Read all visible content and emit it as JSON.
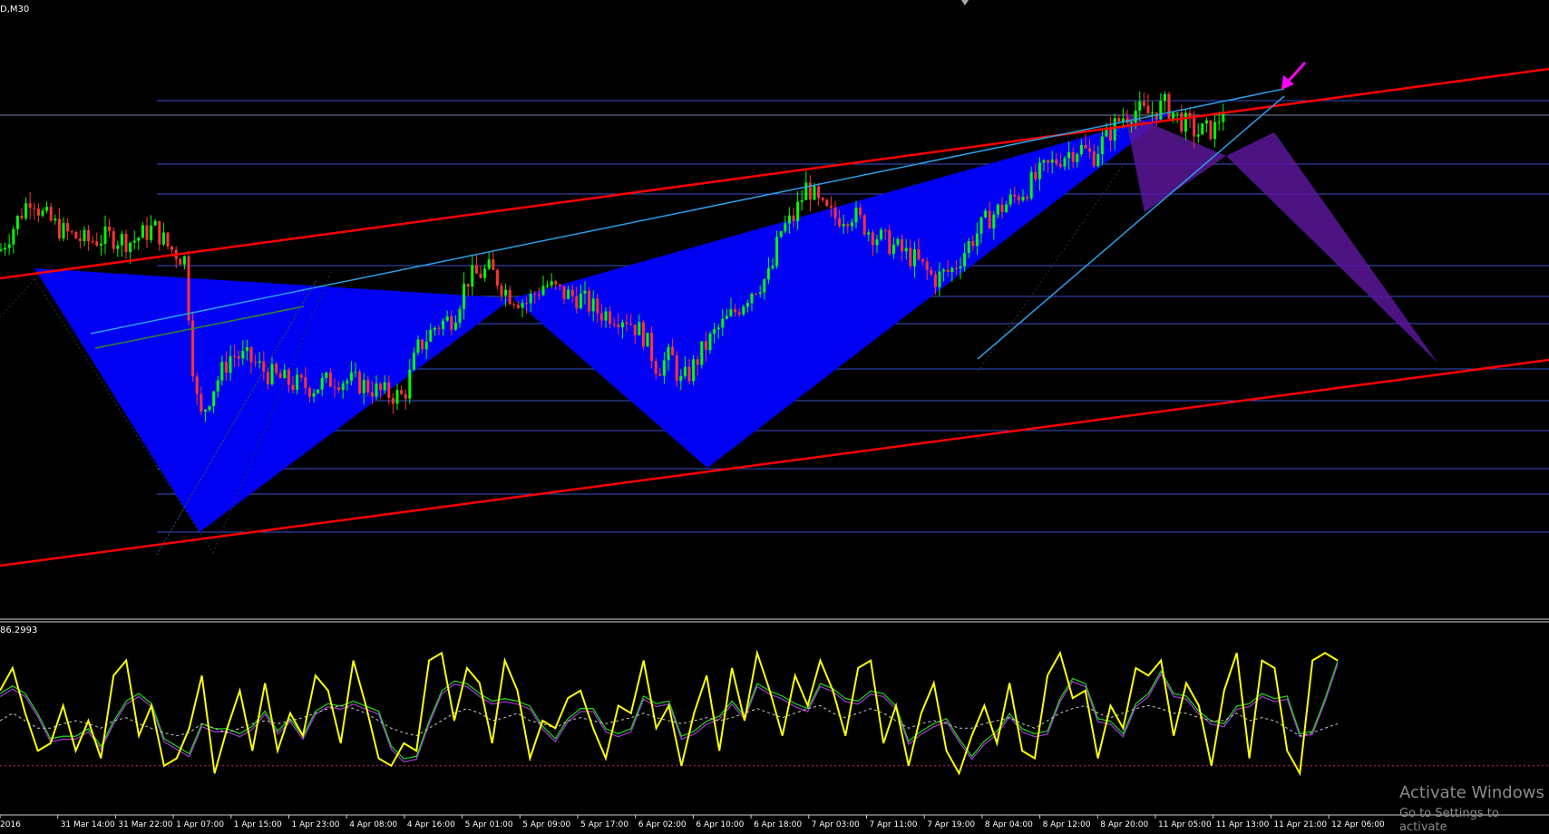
{
  "window": {
    "symbol_label": "D,M30"
  },
  "osc_label": "86.2993",
  "watermark": {
    "title": "Activate Windows",
    "subtitle": "Go to Settings to activate"
  },
  "colors": {
    "background": "#000000",
    "candle_up": "#00ff00",
    "candle_down": "#ff3333",
    "grid": "#3a50c8",
    "pattern_fill": "#0000ff",
    "pattern2_fill": "#5a169a",
    "trend_red": "#ff0000",
    "trend_blue": "#2aa0e8",
    "trend_green": "#2e8b2e",
    "arrow": "#ff00ff",
    "osc_main": "#ffff00",
    "osc_signal_a": "#22cc22",
    "osc_signal_b": "#9a3ad0",
    "osc_ma": "#cccccc",
    "osc_level": "#cc2266"
  },
  "chart_data": [
    {
      "type": "candlestick",
      "timeframe": "M30",
      "x_ticks": [
        "2016",
        "31 Mar 14:00",
        "31 Mar 22:00",
        "1 Apr 07:00",
        "1 Apr 15:00",
        "1 Apr 23:00",
        "4 Apr 08:00",
        "4 Apr 16:00",
        "5 Apr 01:00",
        "5 Apr 09:00",
        "5 Apr 17:00",
        "6 Apr 02:00",
        "6 Apr 10:00",
        "6 Apr 18:00",
        "7 Apr 03:00",
        "7 Apr 11:00",
        "7 Apr 19:00",
        "8 Apr 04:00",
        "8 Apr 12:00",
        "8 Apr 20:00",
        "11 Apr 05:00",
        "11 Apr 13:00",
        "11 Apr 21:00",
        "12 Apr 06:00"
      ],
      "ylim": [
        0,
        100
      ],
      "price_path": [
        [
          0,
          66
        ],
        [
          35,
          78
        ],
        [
          45,
          74
        ],
        [
          70,
          70
        ],
        [
          95,
          68
        ],
        [
          120,
          69
        ],
        [
          145,
          68
        ],
        [
          170,
          71
        ],
        [
          185,
          67
        ],
        [
          205,
          64
        ],
        [
          210,
          46
        ],
        [
          220,
          30
        ],
        [
          235,
          37
        ],
        [
          255,
          44
        ],
        [
          275,
          43
        ],
        [
          295,
          40
        ],
        [
          320,
          38
        ],
        [
          345,
          37
        ],
        [
          370,
          39
        ],
        [
          395,
          38
        ],
        [
          420,
          36
        ],
        [
          445,
          35
        ],
        [
          460,
          45
        ],
        [
          480,
          50
        ],
        [
          500,
          52
        ],
        [
          515,
          60
        ],
        [
          540,
          62
        ],
        [
          560,
          57
        ],
        [
          580,
          55
        ],
        [
          600,
          59
        ],
        [
          620,
          57
        ],
        [
          640,
          56
        ],
        [
          660,
          53
        ],
        [
          690,
          52
        ],
        [
          710,
          48
        ],
        [
          725,
          41
        ],
        [
          740,
          44
        ],
        [
          750,
          38
        ],
        [
          760,
          40
        ],
        [
          775,
          45
        ],
        [
          790,
          49
        ],
        [
          810,
          53
        ],
        [
          830,
          58
        ],
        [
          850,
          61
        ],
        [
          860,
          70
        ],
        [
          875,
          73
        ],
        [
          890,
          80
        ],
        [
          905,
          75
        ],
        [
          920,
          73
        ],
        [
          940,
          74
        ],
        [
          960,
          70
        ],
        [
          985,
          67
        ],
        [
          1010,
          64
        ],
        [
          1030,
          60
        ],
        [
          1050,
          62
        ],
        [
          1070,
          68
        ],
        [
          1090,
          73
        ],
        [
          1110,
          76
        ],
        [
          1130,
          79
        ],
        [
          1150,
          83
        ],
        [
          1170,
          86
        ],
        [
          1190,
          88
        ],
        [
          1205,
          86
        ],
        [
          1215,
          89
        ],
        [
          1235,
          94
        ],
        [
          1250,
          96
        ],
        [
          1265,
          95
        ],
        [
          1285,
          97
        ],
        [
          1300,
          94
        ],
        [
          1320,
          91
        ],
        [
          1340,
          92
        ],
        [
          1352,
          98
        ]
      ],
      "horizontal_levels": [
        111,
        127,
        181,
        214,
        293,
        327,
        357,
        407,
        442,
        475,
        517,
        545,
        587
      ],
      "pattern_1": {
        "points": [
          [
            38,
            296
          ],
          [
            220,
            587
          ],
          [
            565,
            329
          ],
          [
            780,
            516
          ],
          [
            1292,
            124
          ]
        ]
      },
      "pattern_2": {
        "points": [
          [
            1240,
            124
          ],
          [
            1262,
            234
          ],
          [
            1352,
            172
          ],
          [
            1405,
            146
          ],
          [
            1585,
            400
          ]
        ]
      },
      "trendlines": [
        {
          "color": "red",
          "from": [
            0,
            307
          ],
          "to": [
            1708,
            76
          ]
        },
        {
          "color": "red",
          "from": [
            0,
            624
          ],
          "to": [
            1708,
            397
          ]
        },
        {
          "color": "blue",
          "from": [
            100,
            368
          ],
          "to": [
            1416,
            98
          ]
        },
        {
          "color": "blue",
          "from": [
            1078,
            396
          ],
          "to": [
            1416,
            106
          ]
        }
      ],
      "arrow_marker": {
        "at": [
          1413,
          99
        ]
      }
    },
    {
      "type": "line",
      "name": "oscillator",
      "ylim": [
        0,
        100
      ],
      "level_lines": [
        20
      ],
      "series": [
        {
          "values": [
            70,
            85,
            55,
            30,
            35,
            60,
            30,
            50,
            25,
            80,
            90,
            40,
            60,
            20,
            25,
            45,
            80,
            15,
            45,
            70,
            30,
            75,
            30,
            55,
            40,
            80,
            70,
            35,
            90,
            60,
            25,
            20,
            35,
            30,
            90,
            95,
            50,
            85,
            75,
            35,
            90,
            70,
            25,
            50,
            45,
            65,
            70,
            45,
            25,
            60,
            55,
            90,
            45,
            60,
            20,
            55,
            80,
            30,
            85,
            50,
            95,
            70,
            40,
            80,
            60,
            90,
            70,
            40,
            85,
            90,
            35,
            60,
            20,
            55,
            75,
            30,
            15,
            40,
            60,
            35,
            75,
            30,
            25,
            80,
            95,
            65,
            70,
            25,
            60,
            45,
            85,
            80,
            90,
            40,
            75,
            60,
            20,
            70,
            95,
            25,
            90,
            85,
            30,
            15,
            90,
            95,
            90
          ]
        },
        {
          "values": [
            50,
            55,
            50,
            45,
            45,
            48,
            50,
            48,
            45,
            50,
            52,
            48,
            45,
            42,
            40,
            42,
            48,
            45,
            42,
            45,
            48,
            50,
            48,
            50,
            52,
            55,
            58,
            60,
            58,
            55,
            50,
            45,
            42,
            40,
            45,
            50,
            55,
            58,
            55,
            50,
            52,
            55,
            50,
            48,
            45,
            50,
            52,
            50,
            48,
            50,
            52,
            55,
            52,
            50,
            48,
            50,
            52,
            50,
            52,
            55,
            58,
            55,
            52,
            55,
            58,
            60,
            55,
            52,
            55,
            58,
            55,
            50,
            45,
            48,
            50,
            48,
            45,
            45,
            48,
            50,
            52,
            48,
            45,
            50,
            55,
            58,
            60,
            55,
            52,
            55,
            58,
            60,
            58,
            55,
            55,
            52,
            50,
            50,
            55,
            50,
            52,
            50,
            45,
            40,
            42,
            45,
            48
          ]
        }
      ]
    }
  ]
}
